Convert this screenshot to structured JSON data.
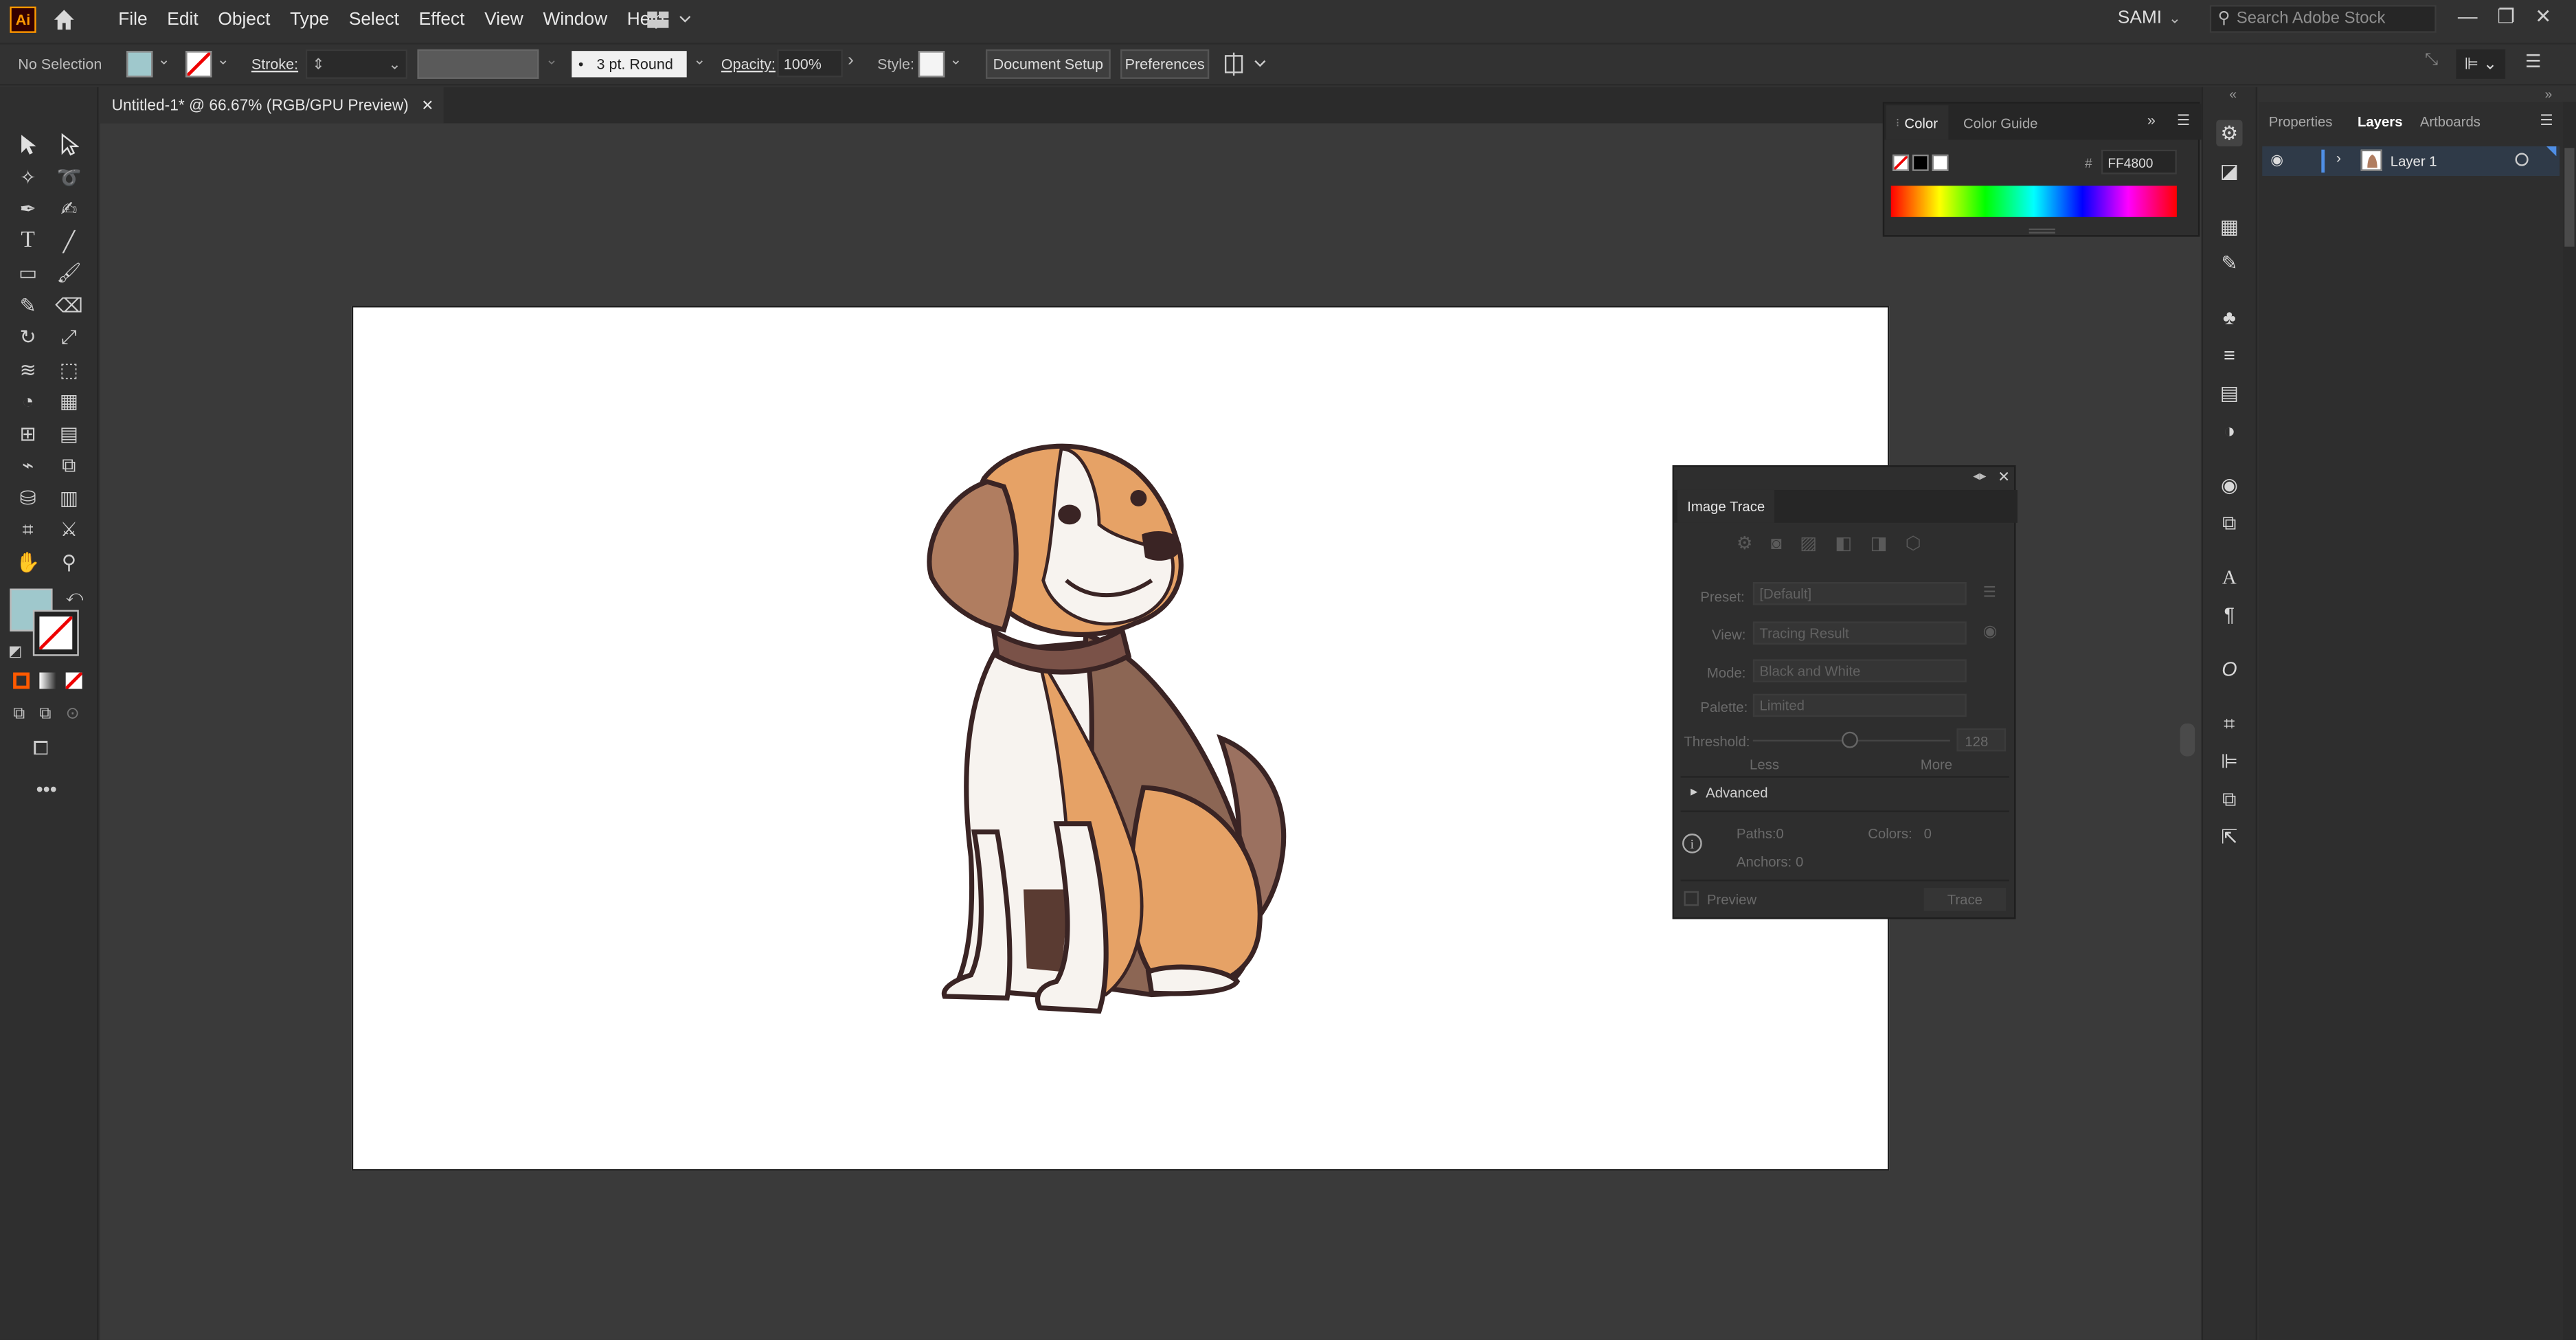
{
  "app": {
    "logo_text": "Ai",
    "user": "SAMI",
    "search_placeholder": "Search Adobe Stock"
  },
  "menu": [
    "File",
    "Edit",
    "Object",
    "Type",
    "Select",
    "Effect",
    "View",
    "Window",
    "Help"
  ],
  "control_bar": {
    "selection": "No Selection",
    "stroke_label": "Stroke:",
    "brush": "3 pt. Round",
    "opacity_label": "Opacity:",
    "opacity_value": "100%",
    "style_label": "Style:",
    "document_setup": "Document Setup",
    "preferences": "Preferences"
  },
  "document": {
    "tab_title": "Untitled-1* @ 66.67% (RGB/GPU Preview)"
  },
  "colors": {
    "fill": "#9fc8cc",
    "accent": "#ff9a00",
    "artboard": "#ffffff"
  },
  "color_panel": {
    "tabs": [
      "Color",
      "Color Guide"
    ],
    "hex_label": "#",
    "hex_value": "FF4800"
  },
  "image_trace": {
    "title": "Image Trace",
    "preset_label": "Preset:",
    "preset_value": "[Default]",
    "view_label": "View:",
    "view_value": "Tracing Result",
    "mode_label": "Mode:",
    "mode_value": "Black and White",
    "palette_label": "Palette:",
    "palette_value": "Limited",
    "threshold_label": "Threshold:",
    "threshold_value": "128",
    "less": "Less",
    "more": "More",
    "advanced": "Advanced",
    "paths": "Paths:",
    "paths_value": "0",
    "colors": "Colors:",
    "colors_value": "0",
    "anchors": "Anchors:",
    "anchors_value": "0",
    "preview": "Preview",
    "trace": "Trace"
  },
  "right_panel": {
    "tabs": [
      "Properties",
      "Layers",
      "Artboards"
    ],
    "layer_name": "Layer 1"
  }
}
